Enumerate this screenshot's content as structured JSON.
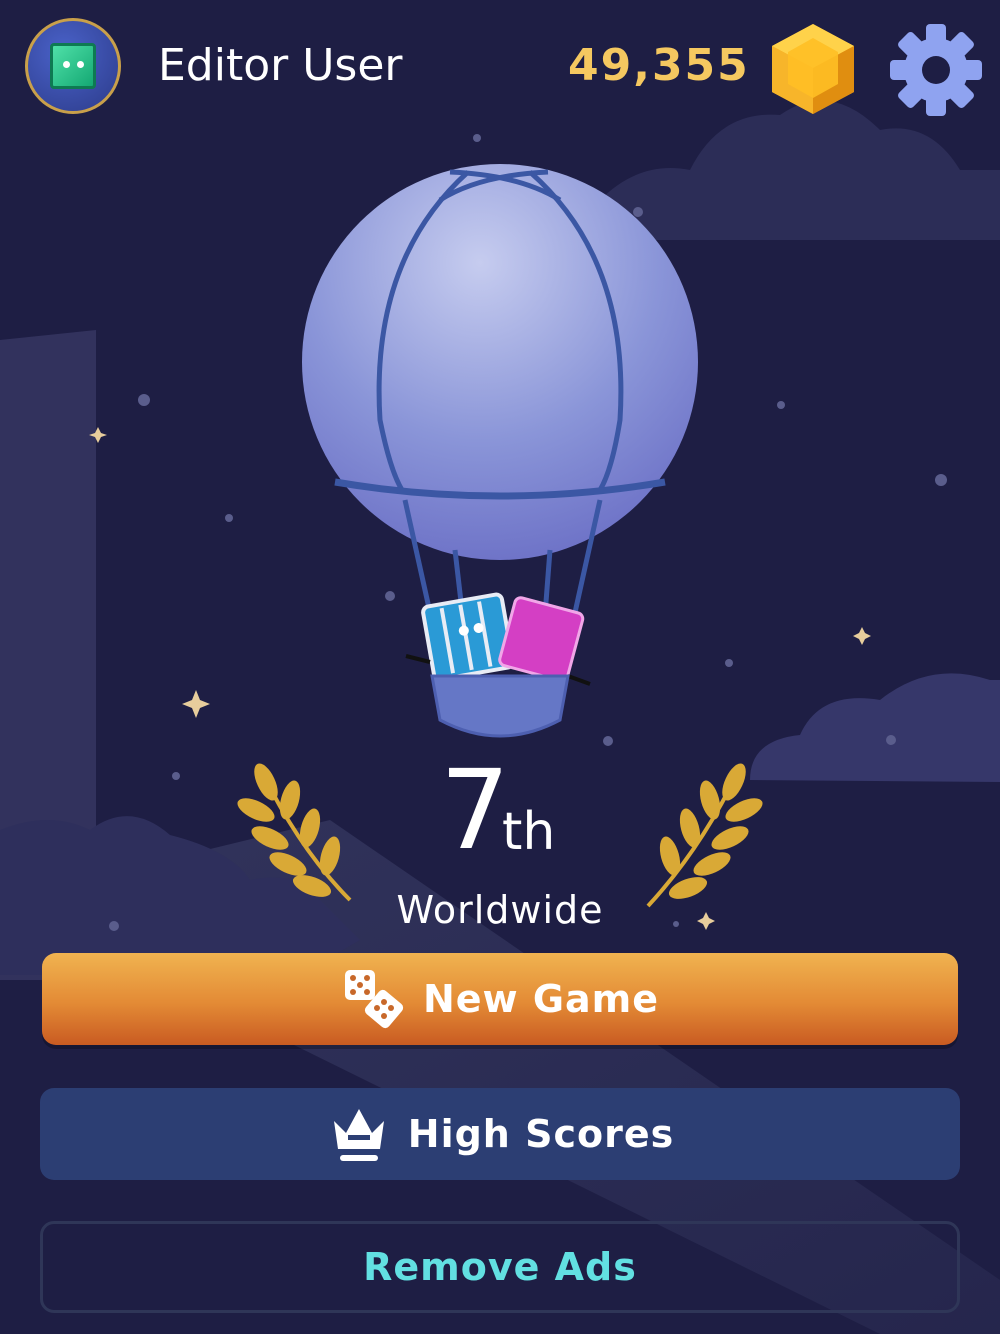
{
  "header": {
    "username": "Editor User",
    "coins": "49,355",
    "avatar_icon": "green-block-character-icon",
    "coin_icon": "gold-hexagon-gem-icon",
    "settings_icon": "gear-icon"
  },
  "ranking": {
    "position": "7",
    "suffix": "th",
    "scope": "Worldwide"
  },
  "buttons": {
    "new_game": {
      "label": "New Game",
      "icon": "dice-icon"
    },
    "high_scores": {
      "label": "High Scores",
      "icon": "crown-icon"
    },
    "remove_ads": {
      "label": "Remove Ads"
    }
  },
  "colors": {
    "background": "#1e1e44",
    "coin_text": "#f5c860",
    "new_game_top": "#f0b350",
    "new_game_bottom": "#c95b22",
    "high_scores_bg": "#2c3e73",
    "remove_ads_text": "#62e0e2",
    "laurel": "#d9a936"
  }
}
